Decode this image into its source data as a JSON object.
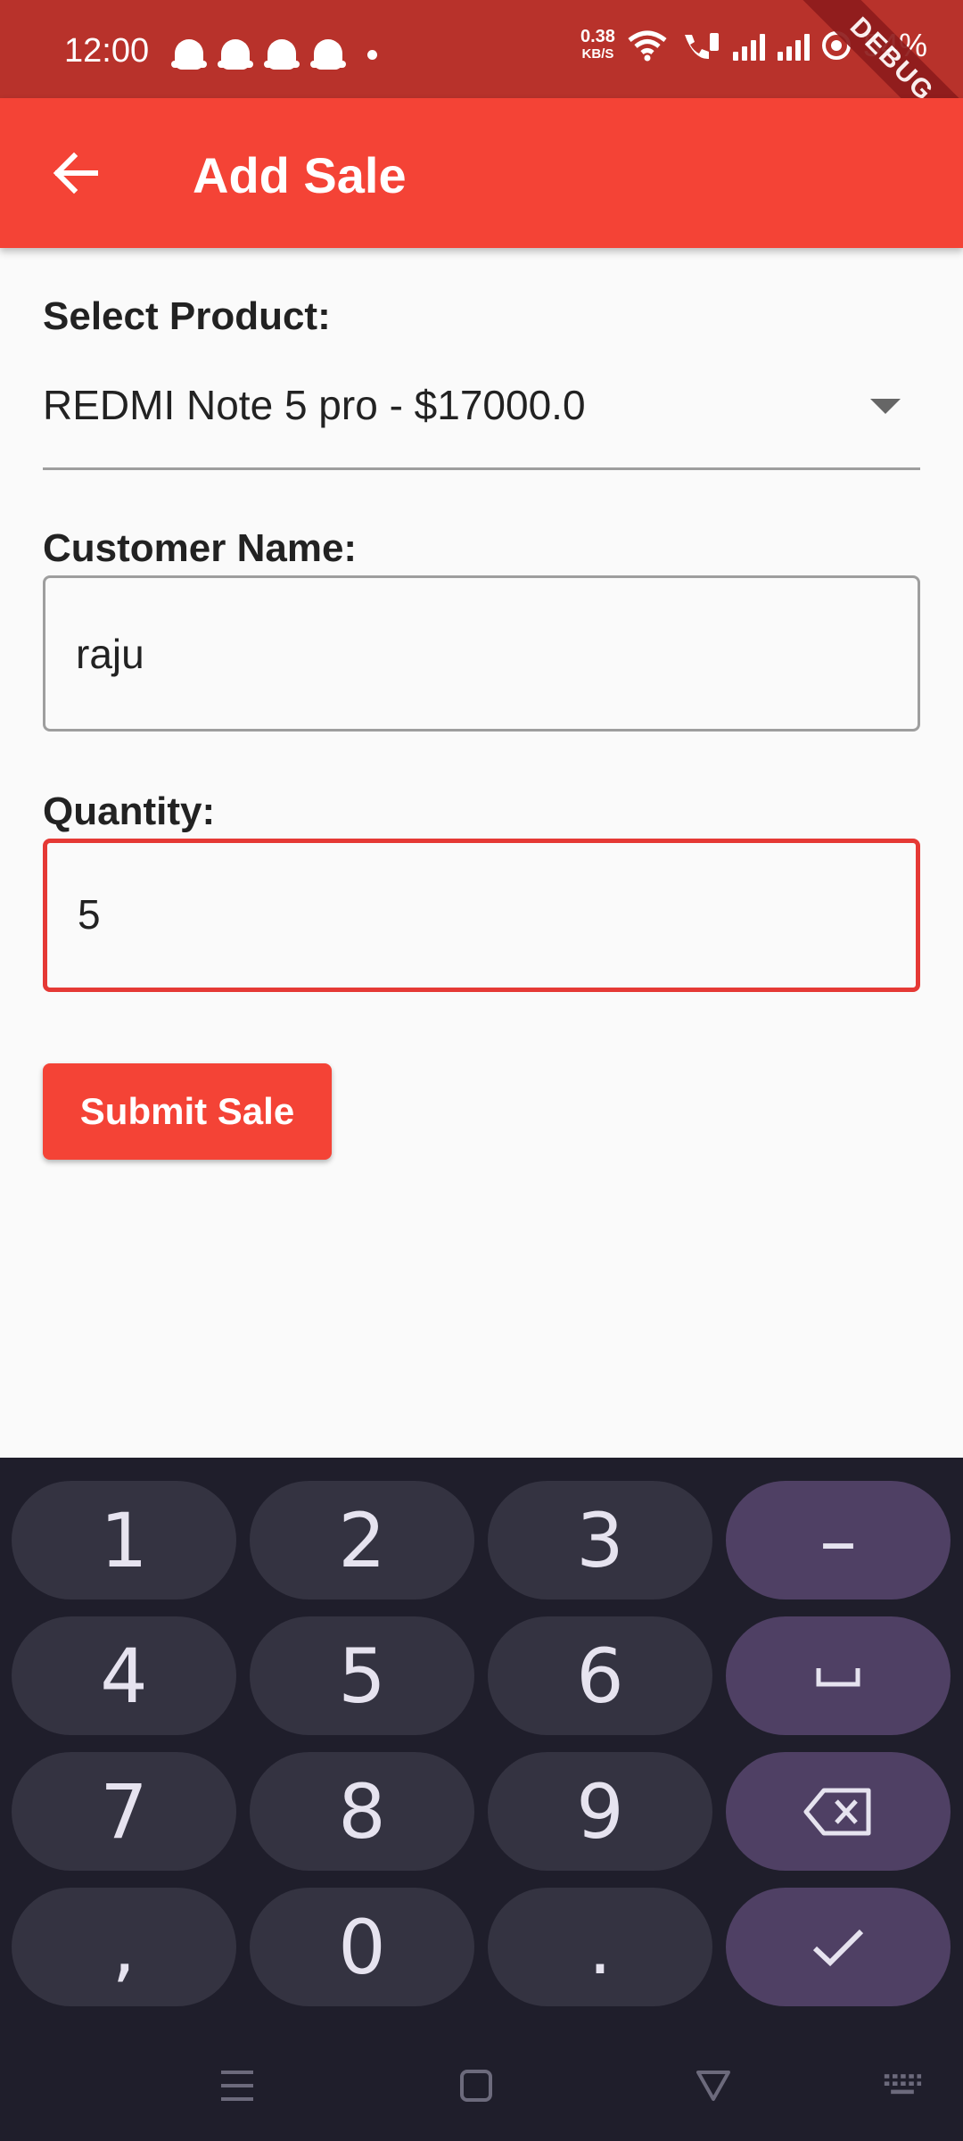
{
  "status_bar": {
    "time": "12:00",
    "net_speed_value": "0.38",
    "net_speed_unit": "KB/S",
    "battery": "54%",
    "debug_banner": "DEBUG",
    "icons": [
      "snapchat-icon",
      "snapchat-icon",
      "snapchat-icon",
      "snapchat-icon",
      "dot-icon",
      "wifi-icon",
      "wifi-calling-icon",
      "signal-icon",
      "signal-icon",
      "battery-ring-icon"
    ]
  },
  "app_bar": {
    "back_icon": "arrow-back-icon",
    "title": "Add Sale",
    "color": "#f44336"
  },
  "form": {
    "product_label": "Select Product:",
    "product_selected": "REDMI Note 5 pro - $17000.0",
    "customer_label": "Customer Name:",
    "customer_value": "raju",
    "quantity_label": "Quantity:",
    "quantity_value": "5",
    "focused_border_color": "#e53935",
    "submit_label": "Submit Sale"
  },
  "keyboard": {
    "keys": [
      [
        "1",
        "2",
        "3",
        "–"
      ],
      [
        "4",
        "5",
        "6",
        "space-icon"
      ],
      [
        "7",
        "8",
        "9",
        "backspace-icon"
      ],
      [
        ",",
        "0",
        ".",
        "checkmark-icon"
      ]
    ],
    "nav_icons": [
      "menu-icon",
      "home-square-icon",
      "back-triangle-icon",
      "keyboard-icon"
    ]
  }
}
